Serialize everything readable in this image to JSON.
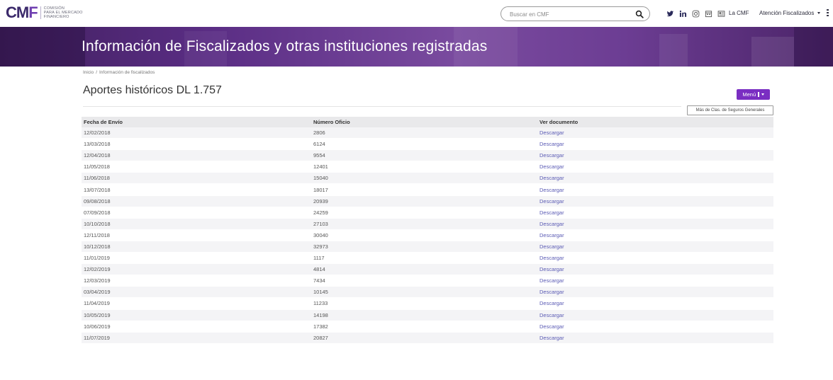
{
  "header": {
    "logo": {
      "mark_part1": "CM",
      "mark_part2": "F",
      "line1": "COMISIÓN",
      "line2": "PARA EL MERCADO",
      "line3": "FINANCIERO"
    },
    "search": {
      "placeholder": "Buscar en CMF"
    },
    "social_icons": [
      "twitter-icon",
      "linkedin-icon",
      "instagram-icon",
      "calendar-icon",
      "newsletter-icon"
    ],
    "nav": {
      "la_cmf": "La CMF",
      "atencion": "Atención Fiscalizados"
    }
  },
  "banner": {
    "title": "Información de Fiscalizados y otras instituciones registradas"
  },
  "breadcrumb": {
    "home": "Inicio",
    "separator": "/",
    "current": "Información de fiscalizados"
  },
  "page": {
    "title": "Aportes históricos DL 1.757",
    "menu_label": "Menú",
    "more_label": "Más de Clas. de Seguros Generales"
  },
  "table": {
    "headers": [
      "Fecha de Envío",
      "Número Oficio",
      "Ver documento"
    ],
    "link_label": "Descargar",
    "rows": [
      {
        "fecha": "12/02/2018",
        "oficio": "2806"
      },
      {
        "fecha": "13/03/2018",
        "oficio": "6124"
      },
      {
        "fecha": "12/04/2018",
        "oficio": "9554"
      },
      {
        "fecha": "11/05/2018",
        "oficio": "12401"
      },
      {
        "fecha": "11/06/2018",
        "oficio": "15040"
      },
      {
        "fecha": "13/07/2018",
        "oficio": "18017"
      },
      {
        "fecha": "09/08/2018",
        "oficio": "20939"
      },
      {
        "fecha": "07/09/2018",
        "oficio": "24259"
      },
      {
        "fecha": "10/10/2018",
        "oficio": "27103"
      },
      {
        "fecha": "12/11/2018",
        "oficio": "30040"
      },
      {
        "fecha": "10/12/2018",
        "oficio": "32973"
      },
      {
        "fecha": "11/01/2019",
        "oficio": "1117"
      },
      {
        "fecha": "12/02/2019",
        "oficio": "4814"
      },
      {
        "fecha": "12/03/2019",
        "oficio": "7434"
      },
      {
        "fecha": "03/04/2019",
        "oficio": "10145"
      },
      {
        "fecha": "11/04/2019",
        "oficio": "11233"
      },
      {
        "fecha": "10/05/2019",
        "oficio": "14198"
      },
      {
        "fecha": "10/06/2019",
        "oficio": "17382"
      },
      {
        "fecha": "11/07/2019",
        "oficio": "20827"
      }
    ]
  },
  "colors": {
    "brand_purple": "#7a2ec2",
    "banner_dark": "#41205f",
    "link": "#5a5ab4"
  }
}
